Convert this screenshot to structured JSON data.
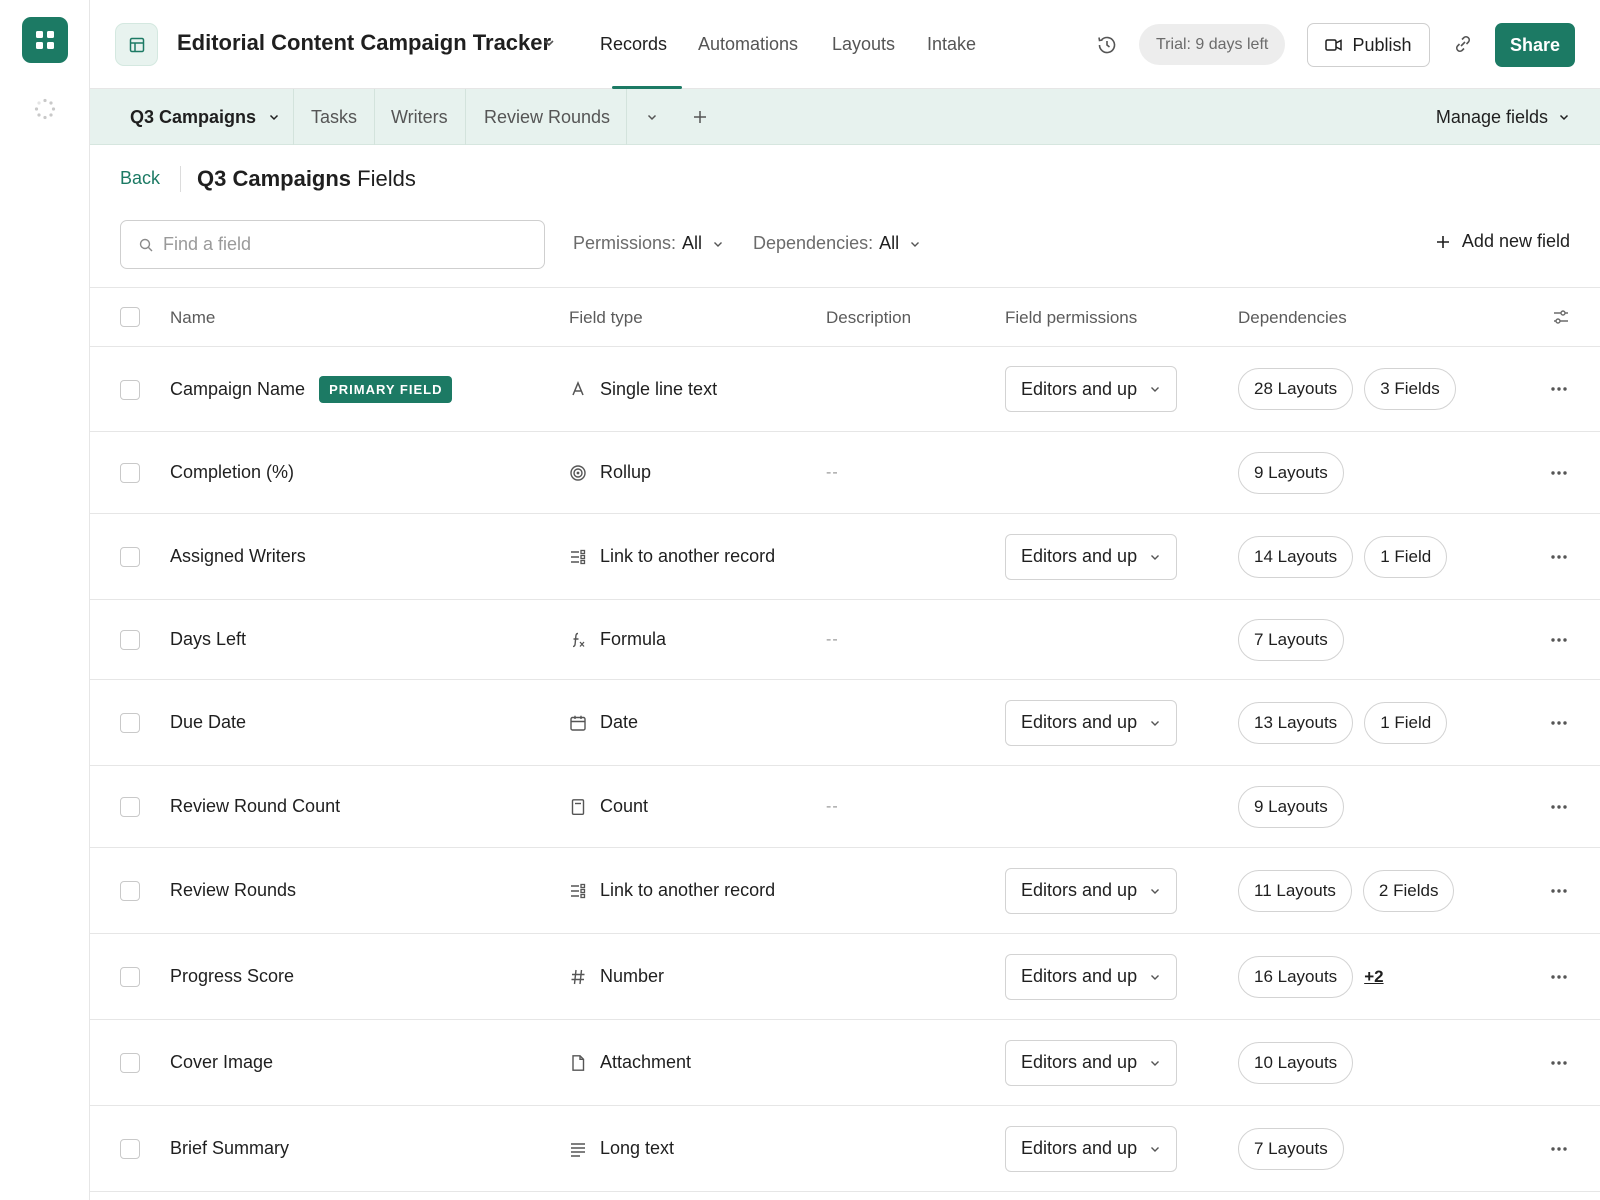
{
  "app": {
    "base_title": "Editorial Content Campaign Tracker",
    "nav_tabs": [
      "Records",
      "Automations",
      "Layouts",
      "Intake"
    ],
    "active_nav": "Records",
    "trial_badge": "Trial: 9 days left",
    "publish_label": "Publish",
    "share_label": "Share",
    "accent_color": "#1c7a64"
  },
  "tables_bar": {
    "tabs": [
      "Q3 Campaigns",
      "Tasks",
      "Writers",
      "Review Rounds"
    ],
    "active_tab": "Q3 Campaigns",
    "manage_fields_label": "Manage fields"
  },
  "page": {
    "back_label": "Back",
    "title_strong": "Q3 Campaigns",
    "title_rest": "Fields",
    "search_placeholder": "Find a field",
    "permissions_filter": {
      "label": "Permissions:",
      "value": "All"
    },
    "dependencies_filter": {
      "label": "Dependencies:",
      "value": "All"
    },
    "add_field_label": "Add new field"
  },
  "table": {
    "columns": [
      "Name",
      "Field type",
      "Description",
      "Field permissions",
      "Dependencies"
    ],
    "primary_badge": "PRIMARY FIELD",
    "rows": [
      {
        "name": "Campaign Name",
        "primary": true,
        "type": "Single line text",
        "icon": "text-icon",
        "description": "",
        "permission": "Editors and up",
        "deps": [
          "28 Layouts",
          "3 Fields"
        ],
        "more": ""
      },
      {
        "name": "Completion (%)",
        "primary": false,
        "type": "Rollup",
        "icon": "rollup-icon",
        "description": "--",
        "permission": "",
        "deps": [
          "9 Layouts"
        ],
        "more": ""
      },
      {
        "name": "Assigned Writers",
        "primary": false,
        "type": "Link to another record",
        "icon": "link-record-icon",
        "description": "",
        "permission": "Editors and up",
        "deps": [
          "14 Layouts",
          "1 Field"
        ],
        "more": ""
      },
      {
        "name": "Days Left",
        "primary": false,
        "type": "Formula",
        "icon": "formula-icon",
        "description": "--",
        "permission": "",
        "deps": [
          "7 Layouts"
        ],
        "more": ""
      },
      {
        "name": "Due Date",
        "primary": false,
        "type": "Date",
        "icon": "calendar-icon",
        "description": "",
        "permission": "Editors and up",
        "deps": [
          "13 Layouts",
          "1 Field"
        ],
        "more": ""
      },
      {
        "name": "Review Round Count",
        "primary": false,
        "type": "Count",
        "icon": "count-icon",
        "description": "--",
        "permission": "",
        "deps": [
          "9 Layouts"
        ],
        "more": ""
      },
      {
        "name": "Review Rounds",
        "primary": false,
        "type": "Link to another record",
        "icon": "link-record-icon",
        "description": "",
        "permission": "Editors and up",
        "deps": [
          "11 Layouts",
          "2 Fields"
        ],
        "more": ""
      },
      {
        "name": "Progress Score",
        "primary": false,
        "type": "Number",
        "icon": "number-icon",
        "description": "",
        "permission": "Editors and up",
        "deps": [
          "16 Layouts"
        ],
        "more": "+2"
      },
      {
        "name": "Cover Image",
        "primary": false,
        "type": "Attachment",
        "icon": "attachment-icon",
        "description": "",
        "permission": "Editors and up",
        "deps": [
          "10 Layouts"
        ],
        "more": ""
      },
      {
        "name": "Brief Summary",
        "primary": false,
        "type": "Long text",
        "icon": "long-text-icon",
        "description": "",
        "permission": "Editors and up",
        "deps": [
          "7 Layouts"
        ],
        "more": ""
      }
    ]
  }
}
